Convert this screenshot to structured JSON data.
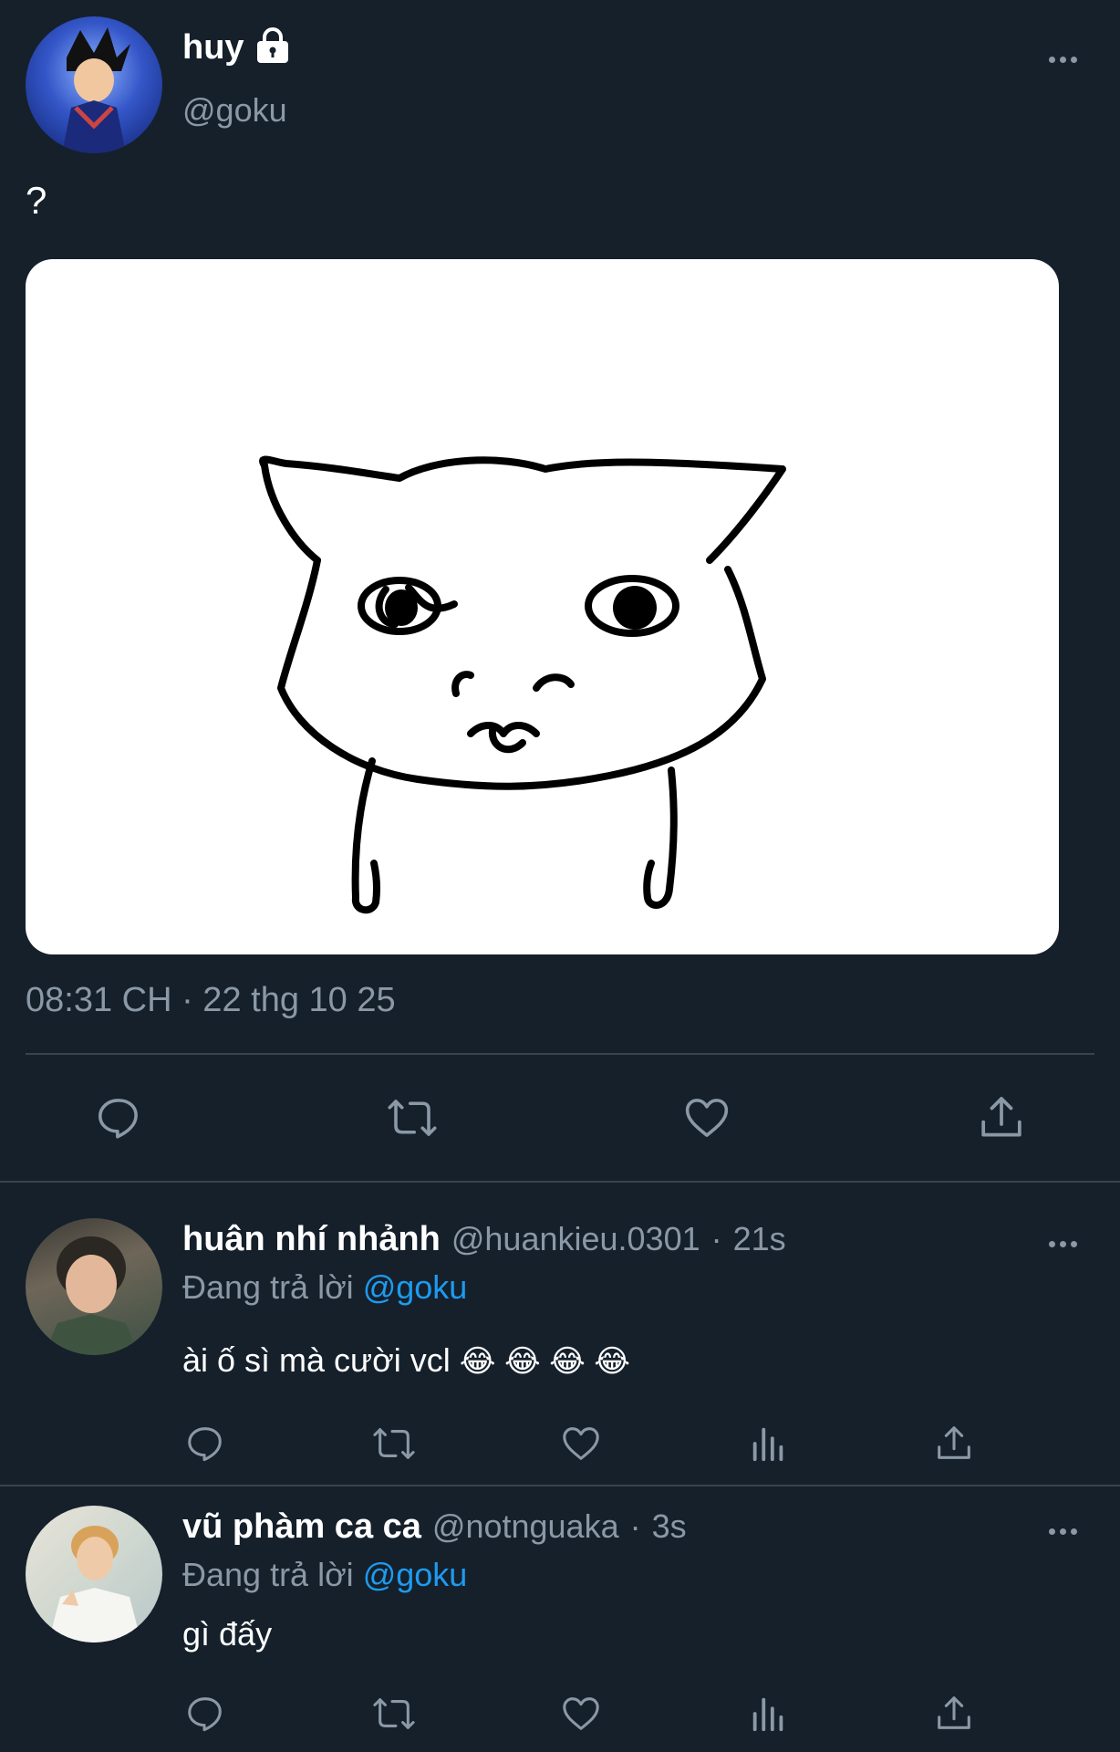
{
  "main_tweet": {
    "display_name": "huy",
    "handle": "@goku",
    "text": "?",
    "timestamp": "08:31 CH · 22 thg 10 25",
    "actions": [
      "reply-icon",
      "retweet-icon",
      "like-icon",
      "share-icon"
    ]
  },
  "replies": [
    {
      "display_name": "huân nhí nhảnh",
      "handle": "@huankieu.0301",
      "sep": "·",
      "time": "21s",
      "replying_prefix": "Đang trả lời",
      "replying_to": "@goku",
      "text": "ài ố sì mà cười vcl",
      "emoji": "😂 😂 😂 😂"
    },
    {
      "display_name": "vũ phàm ca ca",
      "handle": "@notnguaka",
      "sep": "·",
      "time": "3s",
      "replying_prefix": "Đang trả lời",
      "replying_to": "@goku",
      "text": "gì đấy",
      "emoji": ""
    }
  ],
  "colors": {
    "background": "#15202b",
    "muted_text": "#8b98a5",
    "link": "#1d9bf0",
    "divider": "#38444d"
  }
}
